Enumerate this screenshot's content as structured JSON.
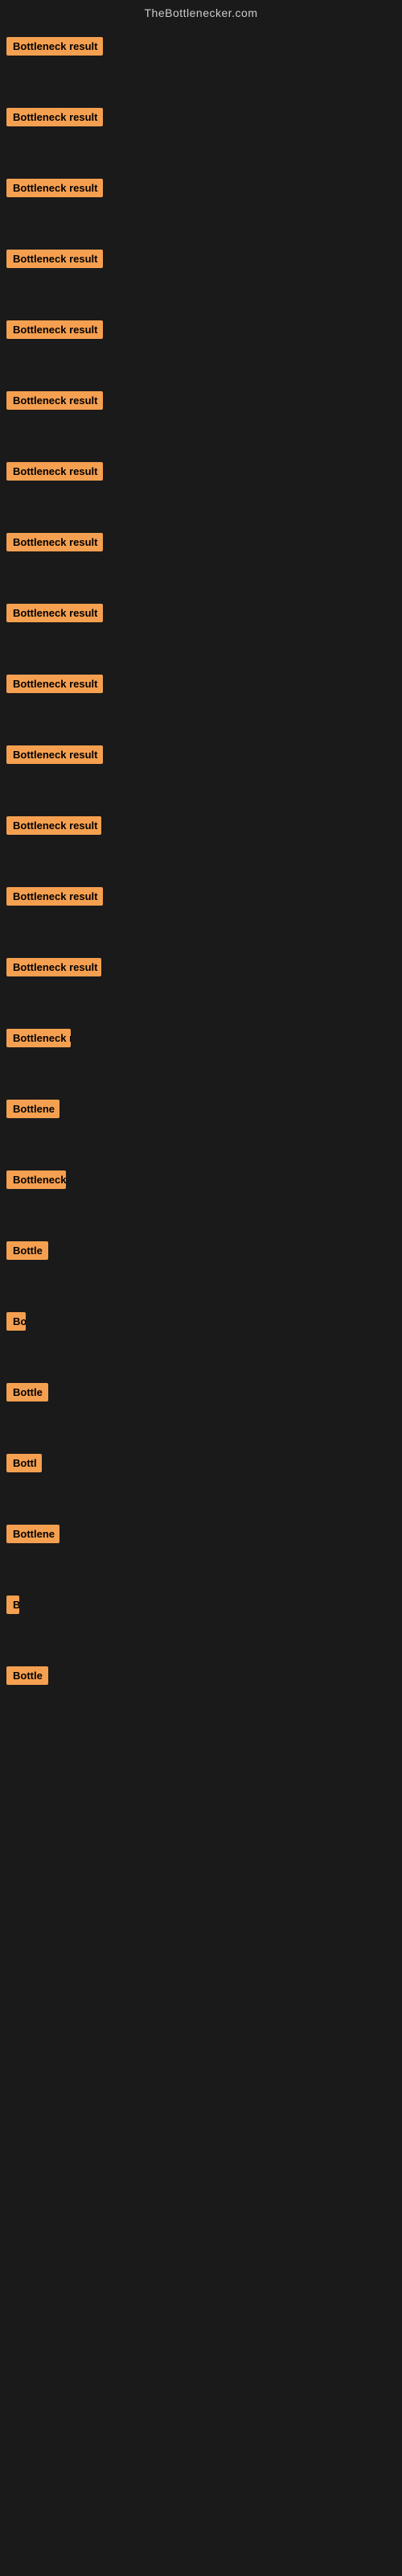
{
  "site": {
    "title": "TheBottlenecker.com"
  },
  "items": [
    {
      "id": 1,
      "label": "Bottleneck result",
      "width": 120
    },
    {
      "id": 2,
      "label": "Bottleneck result",
      "width": 120
    },
    {
      "id": 3,
      "label": "Bottleneck result",
      "width": 120
    },
    {
      "id": 4,
      "label": "Bottleneck result",
      "width": 120
    },
    {
      "id": 5,
      "label": "Bottleneck result",
      "width": 120
    },
    {
      "id": 6,
      "label": "Bottleneck result",
      "width": 120
    },
    {
      "id": 7,
      "label": "Bottleneck result",
      "width": 120
    },
    {
      "id": 8,
      "label": "Bottleneck result",
      "width": 120
    },
    {
      "id": 9,
      "label": "Bottleneck result",
      "width": 120
    },
    {
      "id": 10,
      "label": "Bottleneck result",
      "width": 120
    },
    {
      "id": 11,
      "label": "Bottleneck result",
      "width": 120
    },
    {
      "id": 12,
      "label": "Bottleneck result",
      "width": 118
    },
    {
      "id": 13,
      "label": "Bottleneck result",
      "width": 120
    },
    {
      "id": 14,
      "label": "Bottleneck result",
      "width": 118
    },
    {
      "id": 15,
      "label": "Bottleneck r",
      "width": 80
    },
    {
      "id": 16,
      "label": "Bottlene",
      "width": 66
    },
    {
      "id": 17,
      "label": "Bottleneck",
      "width": 74
    },
    {
      "id": 18,
      "label": "Bottle",
      "width": 52
    },
    {
      "id": 19,
      "label": "Bo",
      "width": 24
    },
    {
      "id": 20,
      "label": "Bottle",
      "width": 52
    },
    {
      "id": 21,
      "label": "Bottl",
      "width": 44
    },
    {
      "id": 22,
      "label": "Bottlene",
      "width": 66
    },
    {
      "id": 23,
      "label": "B",
      "width": 16
    },
    {
      "id": 24,
      "label": "Bottle",
      "width": 52
    }
  ],
  "colors": {
    "background": "#1a1a1a",
    "badge_bg": "#f5a050",
    "badge_text": "#000000",
    "title_text": "#cccccc"
  }
}
